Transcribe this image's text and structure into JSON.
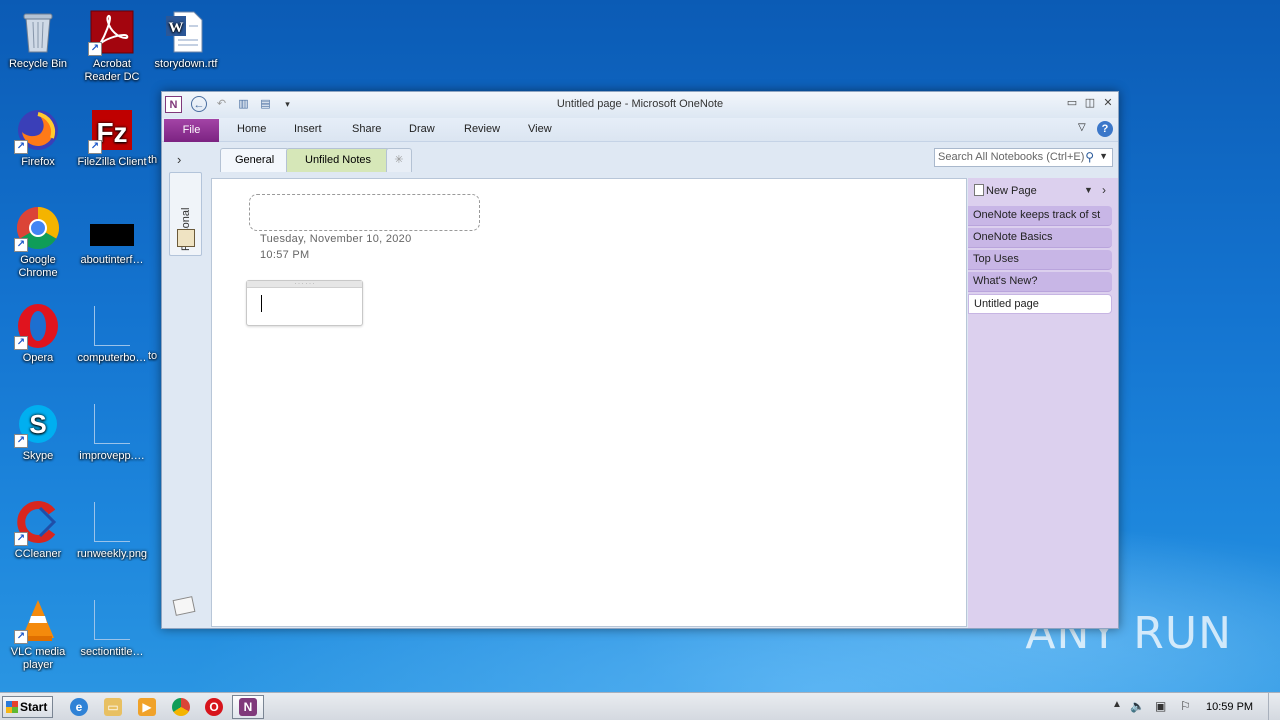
{
  "desktop": {
    "icons": [
      {
        "label": "Recycle Bin",
        "icon": "recycle-bin-icon"
      },
      {
        "label": "Acrobat Reader DC",
        "icon": "acrobat-icon"
      },
      {
        "label": "storydown.rtf",
        "icon": "word-document-icon"
      },
      {
        "label": "Firefox",
        "icon": "firefox-icon"
      },
      {
        "label": "FileZilla Client",
        "icon": "filezilla-icon"
      },
      {
        "label": "th",
        "icon": "file-icon"
      },
      {
        "label": "Google Chrome",
        "icon": "chrome-icon"
      },
      {
        "label": "aboutinterf…",
        "icon": "file-icon"
      },
      {
        "label": "Opera",
        "icon": "opera-icon"
      },
      {
        "label": "computerbo…",
        "icon": "file-icon"
      },
      {
        "label": "to",
        "icon": "file-icon"
      },
      {
        "label": "Skype",
        "icon": "skype-icon"
      },
      {
        "label": "improvepp.…",
        "icon": "file-icon"
      },
      {
        "label": "CCleaner",
        "icon": "ccleaner-icon"
      },
      {
        "label": "runweekly.png",
        "icon": "image-file-icon"
      },
      {
        "label": "VLC media player",
        "icon": "vlc-icon"
      },
      {
        "label": "sectiontitle…",
        "icon": "file-icon"
      }
    ],
    "watermark": "ANY RUN"
  },
  "window": {
    "title": "Untitled page - Microsoft OneNote",
    "ribbon_tabs": {
      "file": "File",
      "home": "Home",
      "insert": "Insert",
      "share": "Share",
      "draw": "Draw",
      "review": "Review",
      "view": "View"
    },
    "notebook": {
      "name": "Personal"
    },
    "sections": [
      {
        "label": "General",
        "color": "#f3f7fc",
        "active": true
      },
      {
        "label": "Unfiled Notes",
        "color": "#d6e7b8",
        "active": false
      }
    ],
    "search": {
      "placeholder": "Search All Notebooks (Ctrl+E)"
    },
    "page": {
      "date": "Tuesday, November 10, 2020",
      "time": "10:57 PM"
    },
    "pages_panel": {
      "new_page": "New Page",
      "pages": [
        {
          "label": "OneNote keeps track of st",
          "active": false
        },
        {
          "label": "OneNote Basics",
          "active": false
        },
        {
          "label": "Top Uses",
          "active": false
        },
        {
          "label": "What's New?",
          "active": false
        },
        {
          "label": "Untitled page",
          "active": true
        }
      ]
    }
  },
  "taskbar": {
    "start": "Start",
    "clock": "10:59 PM"
  },
  "colors": {
    "onenote_purple": "#80397b",
    "pages_panel": "#dcd0ee",
    "page_item": "#c8b6e6",
    "desktop_blue": "#1474d0"
  }
}
